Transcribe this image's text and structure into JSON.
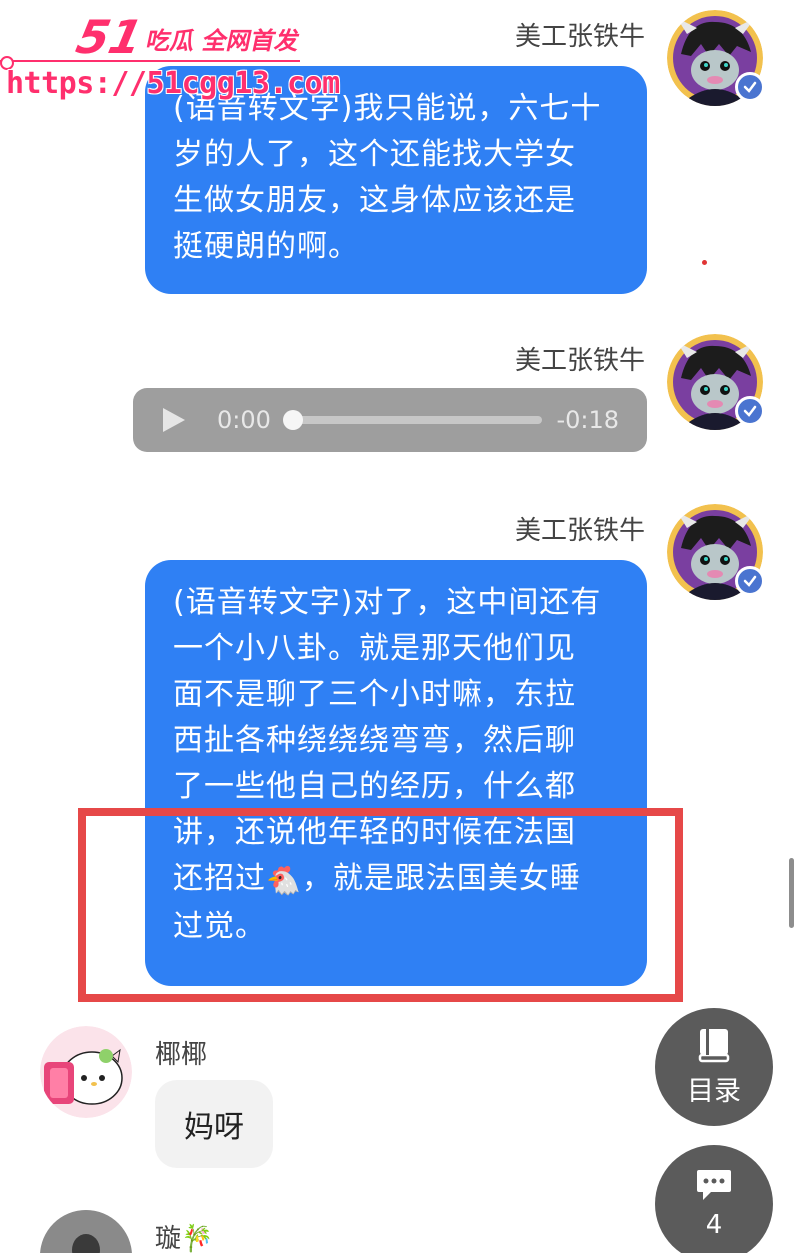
{
  "watermark": {
    "brand_number": "51",
    "brand_text": "吃瓜 全网首发",
    "url": "https://51cgg13.com"
  },
  "messages": [
    {
      "sender": "美工张铁牛",
      "type": "text",
      "text": "(语音转文字)我只能说，六七十\n岁的人了，这个还能找大学女\n生做女朋友，这身体应该还是\n挺硬朗的啊。"
    },
    {
      "sender": "美工张铁牛",
      "type": "audio",
      "current_time": "0:00",
      "remaining_time": "-0:18",
      "progress": 0
    },
    {
      "sender": "美工张铁牛",
      "type": "text",
      "text_part1": "(语音转文字)对了，这中间还有\n一个小八卦。就是那天他们见\n面不是聊了三个小时嘛，东拉\n西扯各种绕绕绕弯弯，然后聊\n了一些他自己的经历，什么都\n讲，还说他年轻的时候在法国\n还招过",
      "emoji": "🐔",
      "text_part2": "，就是跟法国美女睡\n过觉。"
    }
  ],
  "replies": [
    {
      "sender": "椰椰",
      "text": "妈呀"
    },
    {
      "sender": "璇",
      "sender_suffix": "🎋"
    }
  ],
  "floating_buttons": {
    "catalog_label": "目录",
    "comments_count": "4"
  },
  "colors": {
    "bubble_blue": "#2f80f4",
    "highlight_red": "#e64848",
    "watermark_pink": "#ff2f6d",
    "fab_gray": "#5b5b5b"
  },
  "icons": {
    "play": "play-icon",
    "book": "book-icon",
    "comment": "comment-icon",
    "verified": "verified-badge-icon"
  }
}
